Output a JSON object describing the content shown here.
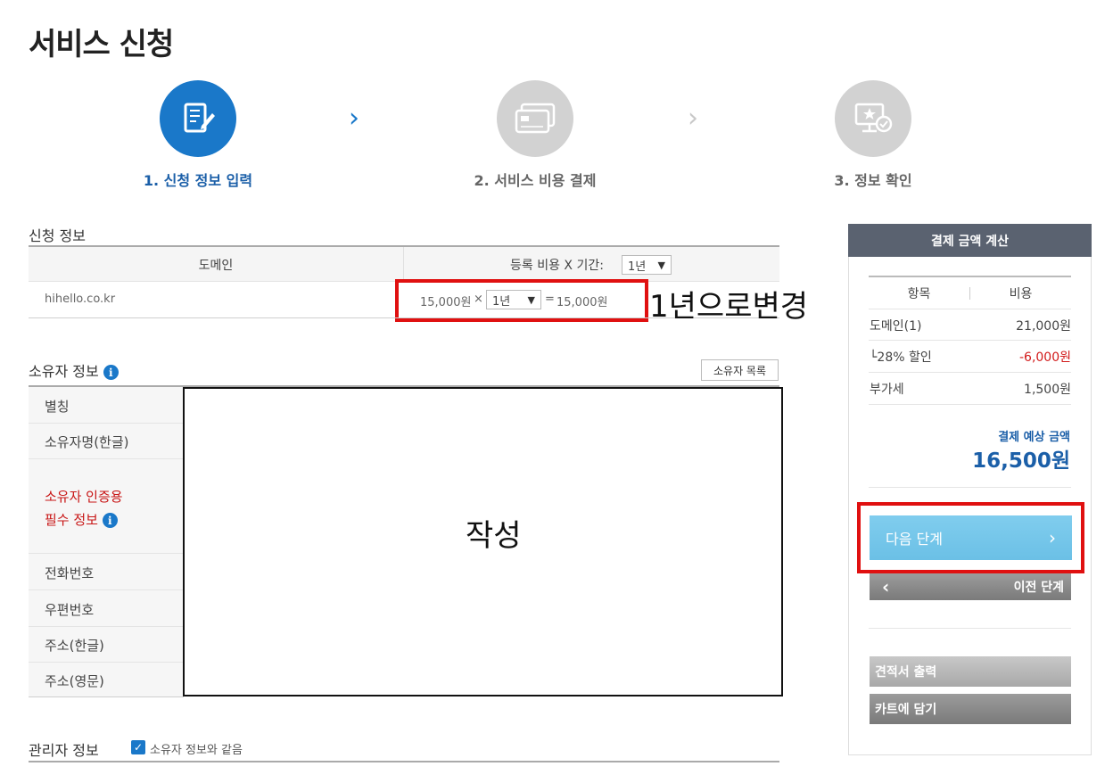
{
  "page": {
    "title": "서비스 신청"
  },
  "steps": [
    {
      "label": "1. 신청 정보 입력",
      "icon": "form-edit-icon",
      "state": "active"
    },
    {
      "label": "2. 서비스 비용 결제",
      "icon": "credit-card-icon",
      "state": "inactive"
    },
    {
      "label": "3. 정보 확인",
      "icon": "monitor-check-icon",
      "state": "inactive"
    }
  ],
  "application": {
    "title": "신청 정보",
    "col_domain": "도메인",
    "col_fee_label": "등록 비용 X 기간:",
    "period_header_value": "1년",
    "rows": [
      {
        "domain": "hihello.co.kr",
        "unit_price": "15,000원",
        "times": "×",
        "period": "1년",
        "equals": "=",
        "total": "15,000원"
      }
    ]
  },
  "annotations": {
    "period_change": "1년으로변경",
    "owner_fill": "작성"
  },
  "owner": {
    "title": "소유자 정보",
    "list_button": "소유자 목록",
    "fields": [
      "별칭",
      "소유자명(한글)"
    ],
    "required_label_1": "소유자 인증용",
    "required_label_2": "필수 정보",
    "fields2": [
      "전화번호",
      "우편번호",
      "주소(한글)",
      "주소(영문)"
    ]
  },
  "admin": {
    "title": "관리자 정보",
    "same_as_owner": "소유자 정보와 같음",
    "same_checked": true
  },
  "payment": {
    "header": "결제 금액 계산",
    "col_item": "항목",
    "col_cost": "비용",
    "rows": [
      {
        "item": "도메인(1)",
        "cost": "21,000원"
      },
      {
        "item": "└28% 할인",
        "cost": "-6,000원"
      },
      {
        "item": "부가세",
        "cost": "1,500원"
      }
    ],
    "estimate_label": "결제 예상 금액",
    "estimate_value": "16,500원",
    "next_button": "다음 단계",
    "prev_button": "이전 단계",
    "quote_button": "견적서 출력",
    "cart_button": "카트에 담기"
  },
  "colors": {
    "primary": "#1a78c9",
    "highlight": "#e01010",
    "next_button": "#6bc0e6",
    "discount": "#d21a1a"
  }
}
